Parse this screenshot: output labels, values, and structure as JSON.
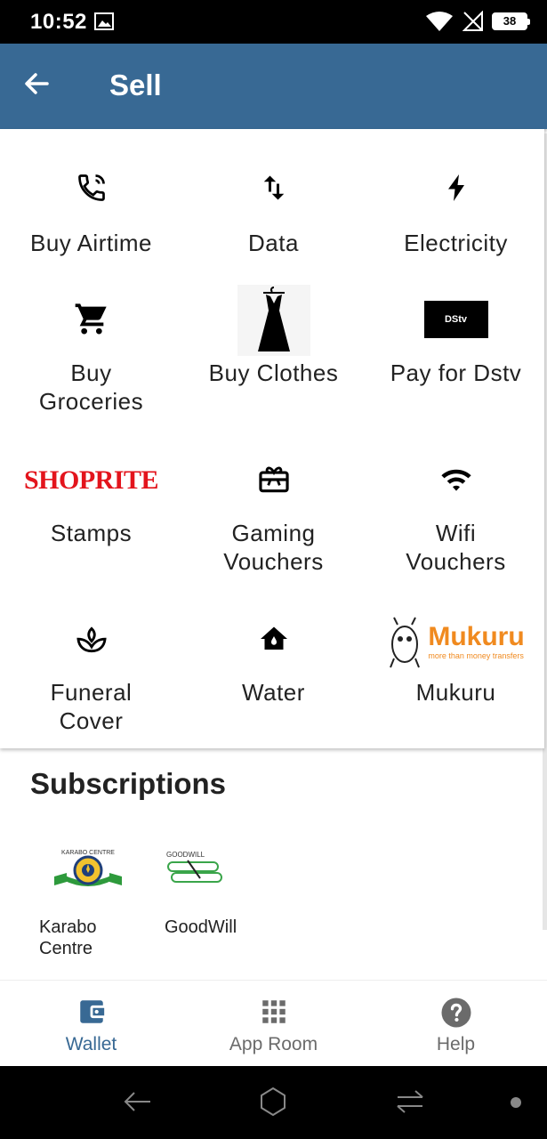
{
  "status_bar": {
    "time": "10:52",
    "battery": "38",
    "icons": [
      "gallery-icon",
      "wifi-icon",
      "no-signal-icon",
      "battery-icon"
    ]
  },
  "app_bar": {
    "title": "Sell",
    "back_icon": "arrow-left-icon"
  },
  "services": [
    {
      "label": "Buy Airtime",
      "icon": "phone-in-talk-icon"
    },
    {
      "label": "Data",
      "icon": "swap-vertical-icon"
    },
    {
      "label": "Electricity",
      "icon": "lightning-bolt-icon"
    },
    {
      "label": "Buy\nGroceries",
      "icon": "cart-icon"
    },
    {
      "label": "Buy Clothes",
      "icon": "dress-icon"
    },
    {
      "label": "Pay for Dstv",
      "icon": "dstv-logo",
      "logo_text": "DStv"
    },
    {
      "label": "Stamps",
      "icon": "shoprite-logo",
      "logo_text": "SHOPRITE"
    },
    {
      "label": "Gaming\nVouchers",
      "icon": "gift-card-icon"
    },
    {
      "label": "Wifi\nVouchers",
      "icon": "wifi-icon"
    },
    {
      "label": "Funeral\nCover",
      "icon": "lotus-icon"
    },
    {
      "label": "Water",
      "icon": "home-icon"
    },
    {
      "label": "Mukuru",
      "icon": "mukuru-logo",
      "logo_text": "Mukuru",
      "logo_tagline": "more than money transfers"
    }
  ],
  "subscriptions": {
    "title": "Subscriptions",
    "items": [
      {
        "label": "Karabo\nCentre",
        "logo_text": "KARABO CENTRE"
      },
      {
        "label": "GoodWill",
        "logo_text": "GOODWILL"
      }
    ]
  },
  "bottom_nav": [
    {
      "label": "Wallet",
      "icon": "wallet-icon",
      "active": true
    },
    {
      "label": "App Room",
      "icon": "apps-grid-icon",
      "active": false
    },
    {
      "label": "Help",
      "icon": "help-circle-icon",
      "active": false
    }
  ],
  "colors": {
    "primary": "#386994",
    "shoprite_red": "#e3141c",
    "mukuru_orange": "#f08a1f",
    "goodwill_green": "#3aa54a"
  }
}
